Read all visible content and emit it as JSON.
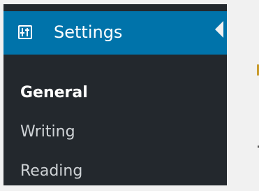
{
  "sidebar": {
    "active_menu": {
      "label": "Settings",
      "icon": "settings-sliders-icon"
    },
    "submenu": [
      {
        "label": "General",
        "current": true
      },
      {
        "label": "Writing",
        "current": false
      },
      {
        "label": "Reading",
        "current": false
      }
    ]
  },
  "colors": {
    "sidebar_bg": "#32373c",
    "submenu_bg": "#23282d",
    "active_bg": "#0073aa",
    "content_bg": "#f1f1f1"
  }
}
